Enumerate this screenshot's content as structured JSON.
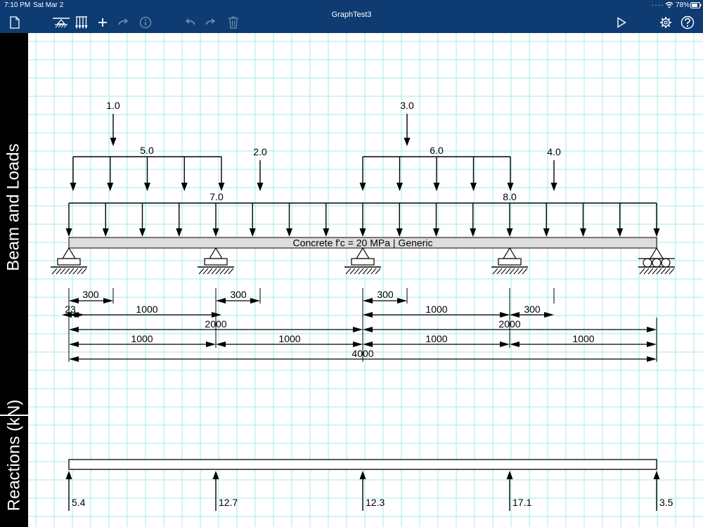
{
  "status": {
    "time": "7:10 PM",
    "date": "Sat Mar 2",
    "battery": "78%"
  },
  "toolbar": {
    "title": "GraphTest3",
    "buttons": [
      {
        "name": "new-document-icon"
      },
      {
        "name": "add-support-icon"
      },
      {
        "name": "add-distributed-load-icon"
      },
      {
        "name": "add-icon"
      },
      {
        "name": "redo-disabled-icon"
      },
      {
        "name": "info-icon"
      },
      {
        "name": "undo-icon"
      },
      {
        "name": "redo-icon"
      },
      {
        "name": "trash-icon"
      },
      {
        "name": "play-icon"
      },
      {
        "name": "settings-icon"
      },
      {
        "name": "help-icon"
      }
    ]
  },
  "sidebar": {
    "beam_label": "Beam and Loads",
    "reactions_label": "Reactions (kN)"
  },
  "colors": {
    "bar": "#0d3b72",
    "grid": "#a6eaec",
    "beam": "#dddddd"
  },
  "beam": {
    "label": "Concrete f'c = 20 MPa | Generic",
    "supports": [
      {
        "type": "pinned"
      },
      {
        "type": "pinned"
      },
      {
        "type": "pinned"
      },
      {
        "type": "pinned"
      },
      {
        "type": "roller"
      }
    ]
  },
  "loads": {
    "point": [
      {
        "label": "1.0"
      },
      {
        "label": "2.0"
      },
      {
        "label": "3.0"
      },
      {
        "label": "4.0"
      }
    ],
    "distributed": [
      {
        "label": "5.0"
      },
      {
        "label": "6.0"
      },
      {
        "label": "7.0"
      },
      {
        "label": "8.0"
      }
    ]
  },
  "dimensions": [
    {
      "label": "300"
    },
    {
      "label": "300"
    },
    {
      "label": "300"
    },
    {
      "label": "300"
    },
    {
      "label": "23"
    },
    {
      "label": "1000"
    },
    {
      "label": "1000"
    },
    {
      "label": "2000"
    },
    {
      "label": "2000"
    },
    {
      "label": "1000"
    },
    {
      "label": "1000"
    },
    {
      "label": "1000"
    },
    {
      "label": "1000"
    },
    {
      "label": "4000"
    }
  ],
  "reactions": [
    {
      "label": "5.4"
    },
    {
      "label": "12.7"
    },
    {
      "label": "12.3"
    },
    {
      "label": "17.1"
    },
    {
      "label": "3.5"
    }
  ]
}
